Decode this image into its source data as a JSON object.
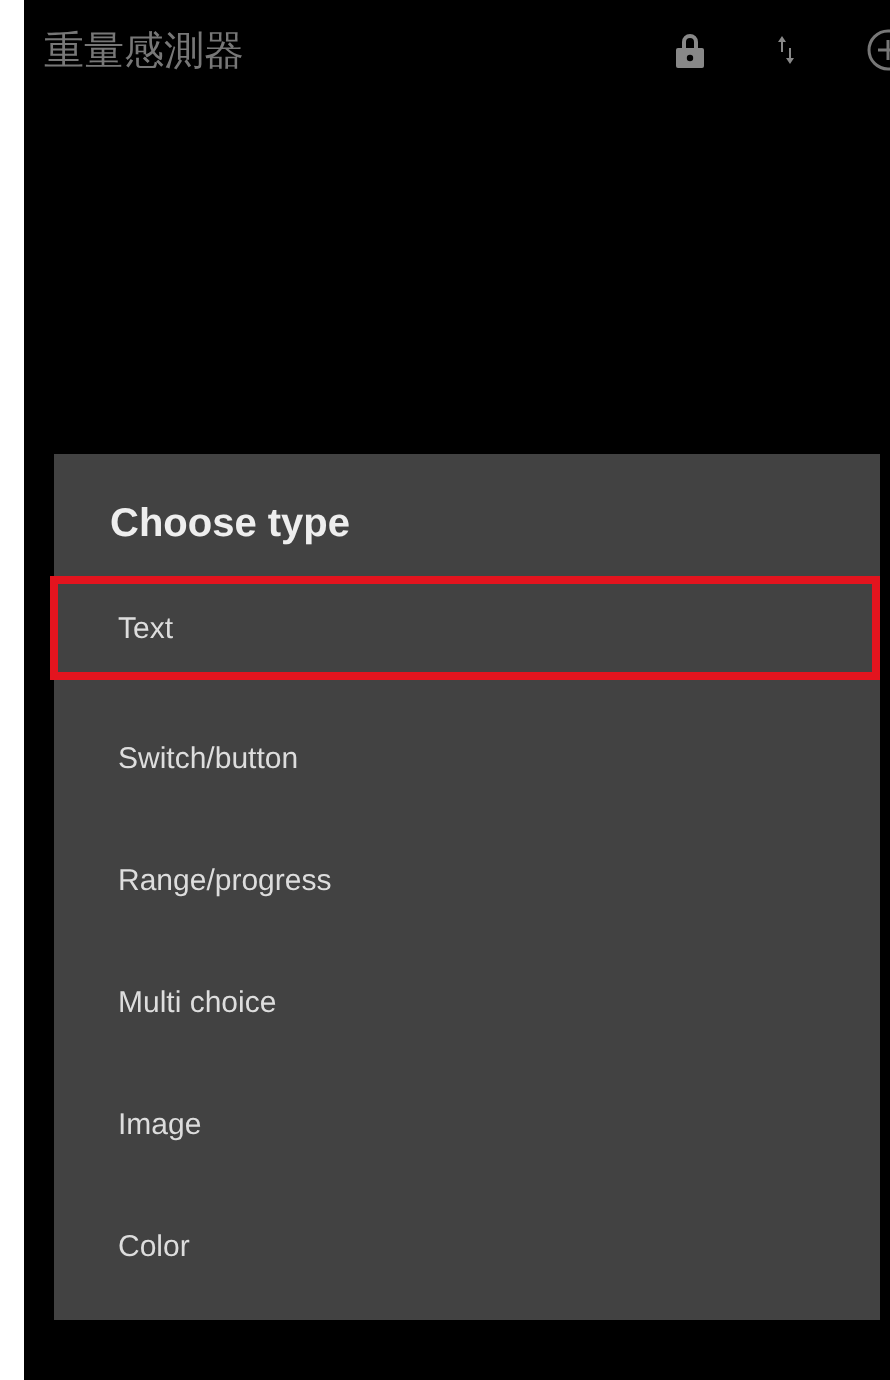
{
  "app_bar": {
    "title": "重量感測器"
  },
  "dialog": {
    "title": "Choose type",
    "items": [
      {
        "label": "Text",
        "selected": true
      },
      {
        "label": "Switch/button",
        "selected": false
      },
      {
        "label": "Range/progress",
        "selected": false
      },
      {
        "label": "Multi choice",
        "selected": false
      },
      {
        "label": "Image",
        "selected": false
      },
      {
        "label": "Color",
        "selected": false
      }
    ]
  }
}
